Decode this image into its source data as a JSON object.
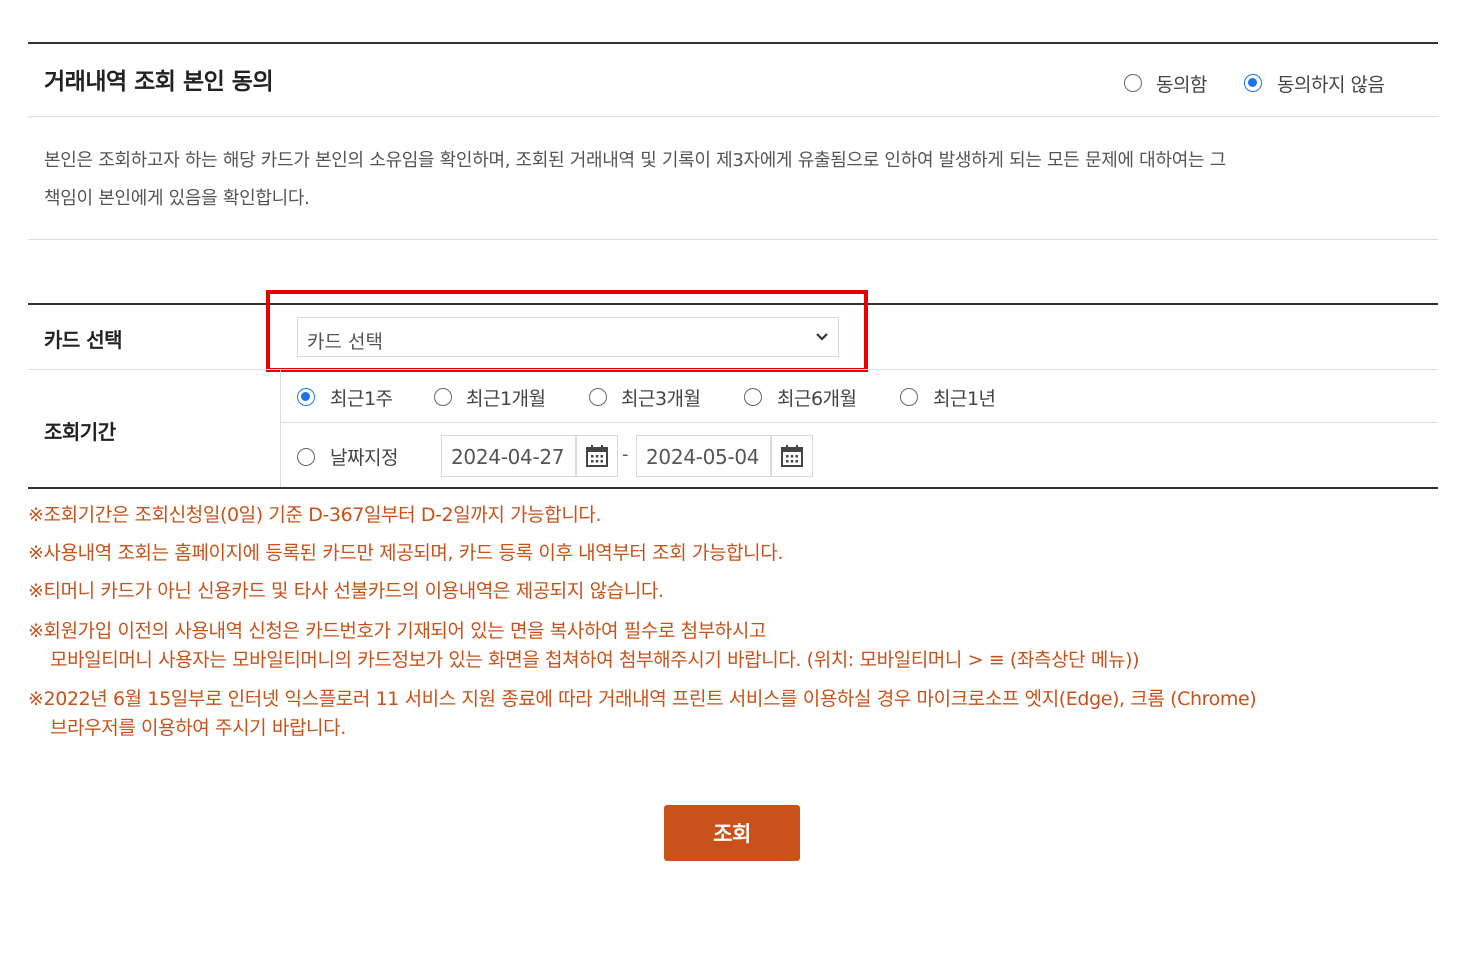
{
  "consent": {
    "title": "거래내역 조회 본인 동의",
    "options": [
      {
        "label": "동의함",
        "checked": false
      },
      {
        "label": "동의하지 않음",
        "checked": true
      }
    ],
    "notice_line1": "본인은 조회하고자 하는 해당 카드가 본인의 소유임을 확인하며, 조회된 거래내역 및 기록이 제3자에게 유출됨으로 인하여 발생하게 되는 모든 문제에 대하여는 그",
    "notice_line2": "책임이 본인에게 있음을 확인합니다."
  },
  "form": {
    "card_label": "카드 선택",
    "card_select_value": "카드 선택",
    "period_label": "조회기간",
    "period_options": [
      {
        "label": "최근1주",
        "checked": true
      },
      {
        "label": "최근1개월",
        "checked": false
      },
      {
        "label": "최근3개월",
        "checked": false
      },
      {
        "label": "최근6개월",
        "checked": false
      },
      {
        "label": "최근1년",
        "checked": false
      }
    ],
    "custom_date_label": "날짜지정",
    "custom_date_checked": false,
    "start_date": "2024-04-27",
    "date_separator": "-",
    "end_date": "2024-05-04"
  },
  "notes": [
    "※조회기간은 조회신청일(0일) 기준 D-367일부터 D-2일까지 가능합니다.",
    "※사용내역 조회는 홈페이지에 등록된 카드만 제공되며, 카드 등록 이후 내역부터 조회 가능합니다.",
    "※티머니 카드가 아닌 신용카드 및 타사 선불카드의 이용내역은 제공되지 않습니다.",
    "※회원가입 이전의 사용내역 신청은 카드번호가 기재되어 있는 면을 복사하여 필수로 첨부하시고",
    "모바일티머니 사용자는 모바일티머니의 카드정보가 있는 화면을 첩쳐하여 첨부해주시기 바랍니다. (위치: 모바일티머니 > ≡ (좌측상단 메뉴))",
    "※2022년 6월 15일부로 인터넷 익스플로러 11 서비스 지원 종료에 따라 거래내역 프린트 서비스를 이용하실 경우 마이크로소프 엣지(Edge), 크롬 (Chrome)",
    "브라우저를 이용하여 주시기 바랍니다."
  ],
  "search_button": "조회",
  "colors": {
    "accent": "#c8521a",
    "highlight": "#e60000",
    "radio_checked": "#1a73e8"
  }
}
